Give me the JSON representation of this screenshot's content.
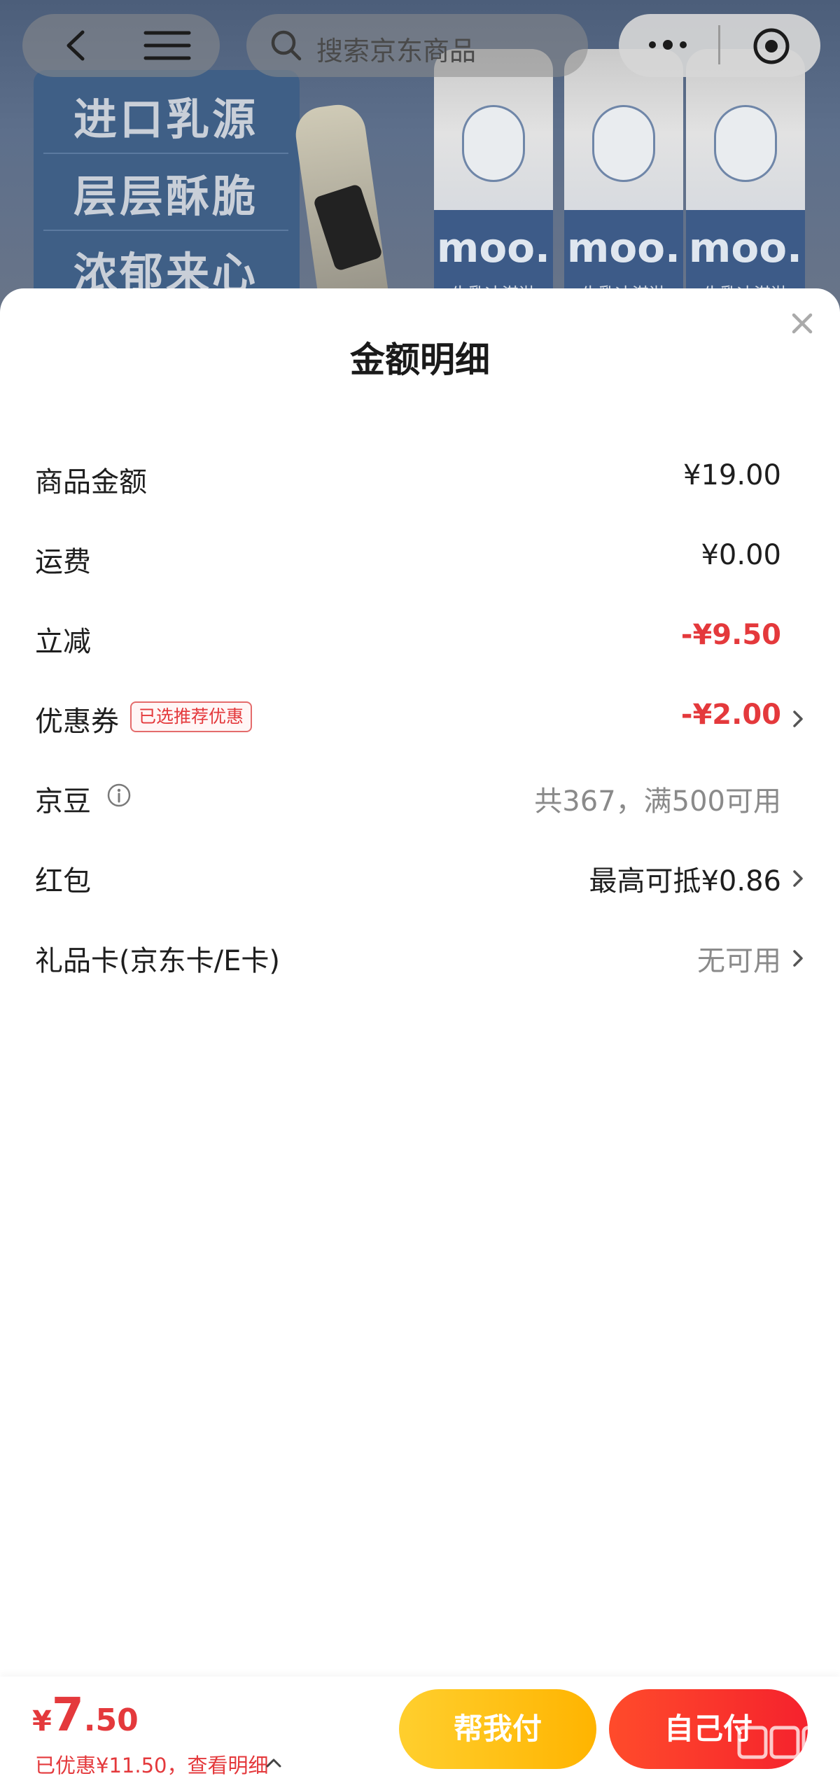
{
  "background": {
    "search_placeholder": "搜索京东商品",
    "slogans": [
      "进口乳源",
      "层层酥脆",
      "浓郁来心"
    ],
    "product_brand": "moo.",
    "product_name": "牛乳冰淇淋",
    "icons": [
      "back-icon",
      "menu-icon",
      "search-icon",
      "more-icon",
      "target-icon"
    ]
  },
  "sheet": {
    "title": "金额明细",
    "close_icon": "close-icon",
    "rows": [
      {
        "label": "商品金额",
        "value": "¥19.00",
        "style": "normal"
      },
      {
        "label": "运费",
        "value": "¥0.00",
        "style": "normal"
      },
      {
        "label": "立减",
        "value": "-¥9.50",
        "style": "red"
      },
      {
        "label": "优惠券",
        "tag": "已选推荐优惠",
        "value": "-¥2.00",
        "style": "red",
        "chevron": true
      },
      {
        "label": "京豆",
        "info_icon": true,
        "value": "共367，满500可用",
        "style": "gray"
      },
      {
        "label": "红包",
        "value": "最高可抵¥0.86",
        "style": "normal",
        "chevron": true
      },
      {
        "label": "礼品卡(京东卡/E卡)",
        "value": "无可用",
        "style": "gray",
        "chevron": true
      }
    ]
  },
  "footer": {
    "price_currency": "¥",
    "price_int": "7",
    "price_dec": ".50",
    "saving_text": "已优惠¥11.50，查看明细",
    "help_pay_button": "帮我付",
    "self_pay_button": "自己付"
  },
  "colors": {
    "accent_red": "#e4393c",
    "button_yellow": "#ffbf00",
    "button_red": "#f5222d"
  }
}
